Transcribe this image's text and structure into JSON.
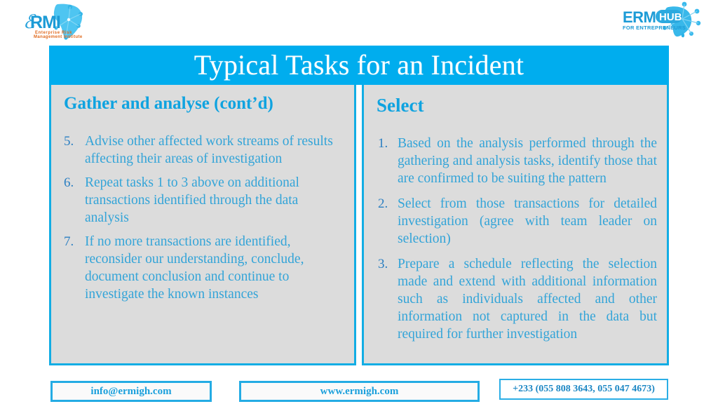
{
  "header": {
    "logo_left": {
      "name": "ermi-logo",
      "mark": "ERMI",
      "tagline_line1": "Enterprise Risk",
      "tagline_line2": "Management Institute"
    },
    "logo_right": {
      "name": "erm-hub-logo",
      "mark": "ERM",
      "badge": "HUB",
      "tagline": "FOR ENTREPRENEURS"
    }
  },
  "title": {
    "text": "Typical Tasks for an Incident"
  },
  "panels": [
    {
      "id": "gather-and-analyse",
      "heading": "Gather and analyse (cont’d)",
      "items": [
        {
          "num": "5.",
          "text": "Advise other affected work streams of results  affecting their areas of investigation"
        },
        {
          "num": "6.",
          "text": "Repeat tasks 1 to 3 above on additional transactions identified through the data analysis"
        },
        {
          "num": "7.",
          "text": "If no more transactions are identified,  reconsider our understanding, conclude, document conclusion and continue to investigate the known instances"
        }
      ]
    },
    {
      "id": "select",
      "heading": "Select",
      "items": [
        {
          "num": "1.",
          "text": "Based on the analysis performed through the gathering and analysis tasks, identify those that  are confirmed to be suiting the pattern"
        },
        {
          "num": "2.",
          "text": "Select from those transactions for detailed  investigation (agree with team leader on  selection)"
        },
        {
          "num": "3.",
          "text": "Prepare a schedule reflecting the selection made and extend with additional information  such as individuals affected and other  information not captured in the data but  required for further investigation"
        }
      ]
    }
  ],
  "footer": {
    "email": "info@ermigh.com",
    "website": "www.ermigh.com",
    "phone": "+233 (055 808 3643, 055 047 4673)"
  },
  "colors": {
    "banner_blue": "#00ADEE",
    "border_blue": "#12ADE4",
    "panel_bg": "#DCDCDC",
    "heading_blue": "#0FA3E0",
    "body_blue": "#33A4D8",
    "number_blue": "#2B7FC2"
  }
}
